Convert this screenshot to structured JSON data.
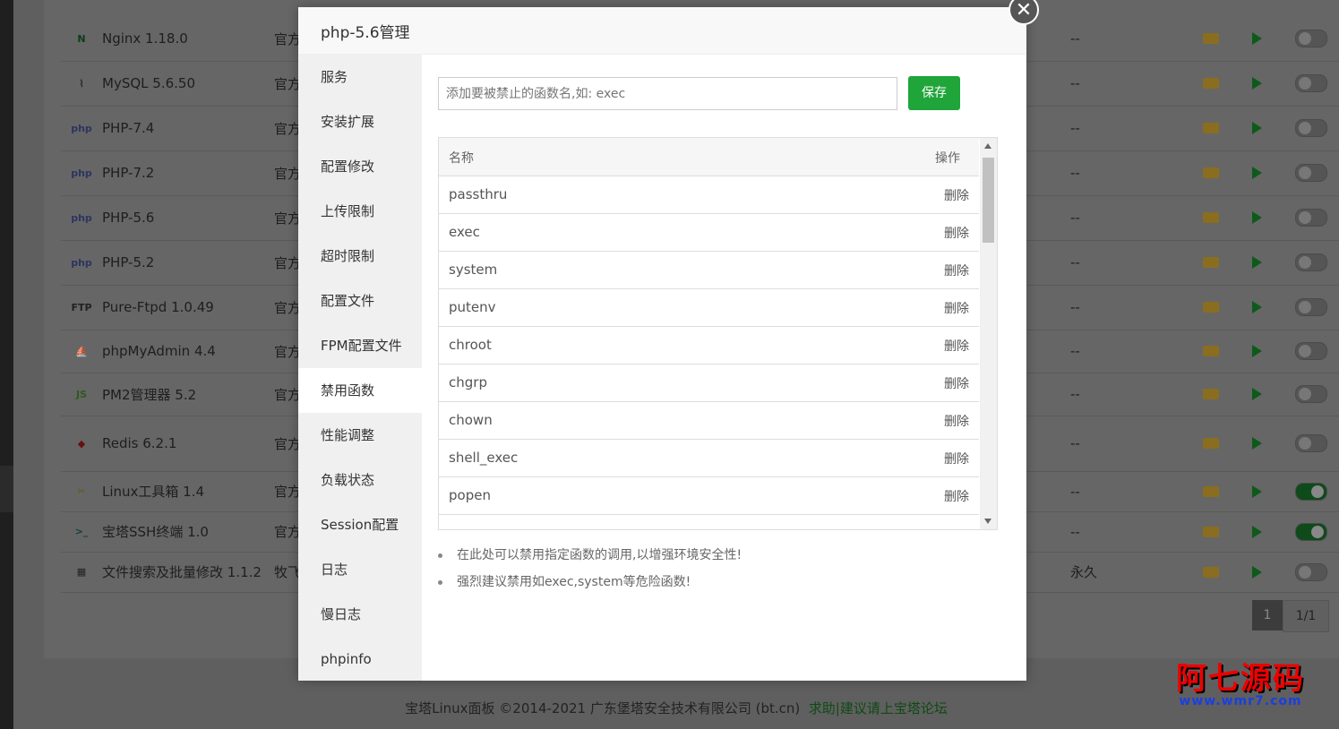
{
  "background": {
    "plugins": [
      {
        "name": "Nginx 1.18.0",
        "dev": "官方",
        "expire": "--",
        "icon": "nginx-icon",
        "enabled": false
      },
      {
        "name": "MySQL 5.6.50",
        "dev": "官方",
        "expire": "--",
        "icon": "mysql-icon",
        "enabled": false
      },
      {
        "name": "PHP-7.4",
        "dev": "官方",
        "expire": "--",
        "icon": "php-icon",
        "enabled": false
      },
      {
        "name": "PHP-7.2",
        "dev": "官方",
        "expire": "--",
        "icon": "php-icon",
        "enabled": false
      },
      {
        "name": "PHP-5.6",
        "dev": "官方",
        "expire": "--",
        "icon": "php-icon",
        "enabled": false
      },
      {
        "name": "PHP-5.2",
        "dev": "官方",
        "expire": "--",
        "icon": "php-icon",
        "enabled": false
      },
      {
        "name": "Pure-Ftpd 1.0.49",
        "dev": "官方",
        "expire": "--",
        "icon": "ftp-icon",
        "enabled": false
      },
      {
        "name": "phpMyAdmin 4.4",
        "dev": "官方",
        "expire": "--",
        "icon": "phpmyadmin-icon",
        "enabled": false
      },
      {
        "name": "PM2管理器 5.2",
        "dev": "官方",
        "expire": "--",
        "icon": "nodejs-icon",
        "enabled": false
      },
      {
        "name": "Redis 6.2.1",
        "dev": "官方",
        "expire": "--",
        "icon": "redis-icon",
        "enabled": false
      },
      {
        "name": "Linux工具箱 1.4",
        "dev": "官方",
        "expire": "--",
        "icon": "tools-icon",
        "enabled": true
      },
      {
        "name": "宝塔SSH终端 1.0",
        "dev": "官方",
        "expire": "--",
        "icon": "terminal-icon",
        "enabled": true
      },
      {
        "name": "文件搜索及批量修改 1.1.2",
        "dev": "牧飞",
        "expire": "永久",
        "icon": "file-search-icon",
        "enabled": false
      }
    ],
    "pager": {
      "current": "1",
      "total": "1/1"
    },
    "footer": {
      "copyright": "宝塔Linux面板 ©2014-2021 广东堡塔安全技术有限公司 (bt.cn)",
      "help_link": "求助|建议请上宝塔论坛"
    },
    "watermark": {
      "line1": "阿七源码",
      "line2": "www.wmr7.com"
    }
  },
  "dialog": {
    "title": "php-5.6管理",
    "close_glyph": "✕",
    "menu": [
      "服务",
      "安装扩展",
      "配置修改",
      "上传限制",
      "超时限制",
      "配置文件",
      "FPM配置文件",
      "禁用函数",
      "性能调整",
      "负载状态",
      "Session配置",
      "日志",
      "慢日志",
      "phpinfo"
    ],
    "active_menu": "禁用函数",
    "input_placeholder": "添加要被禁止的函数名,如: exec",
    "save_label": "保存",
    "table": {
      "col_name": "名称",
      "col_action": "操作",
      "delete_label": "删除",
      "rows": [
        "passthru",
        "exec",
        "system",
        "putenv",
        "chroot",
        "chgrp",
        "chown",
        "shell_exec",
        "popen"
      ]
    },
    "tips": [
      "在此处可以禁用指定函数的调用,以增强环境安全性!",
      "强烈建议禁用如exec,system等危险函数!"
    ]
  }
}
